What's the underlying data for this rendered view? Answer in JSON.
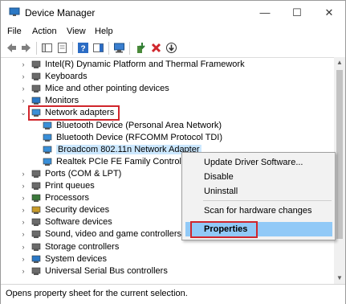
{
  "window": {
    "title": "Device Manager",
    "minimize": "—",
    "maximize": "☐",
    "close": "✕"
  },
  "menu": [
    "File",
    "Action",
    "View",
    "Help"
  ],
  "tree": [
    {
      "label": "Intel(R) Dynamic Platform and Thermal Framework",
      "icon": "platform-icon",
      "indent": 0,
      "expander": "›"
    },
    {
      "label": "Keyboards",
      "icon": "keyboard-icon",
      "indent": 0,
      "expander": "›"
    },
    {
      "label": "Mice and other pointing devices",
      "icon": "mouse-icon",
      "indent": 0,
      "expander": "›"
    },
    {
      "label": "Monitors",
      "icon": "monitor-icon",
      "indent": 0,
      "expander": "›"
    },
    {
      "label": "Network adapters",
      "icon": "network-adapter-icon",
      "indent": 0,
      "expander": "⌄",
      "boxed": true
    },
    {
      "label": "Bluetooth Device (Personal Area Network)",
      "icon": "network-adapter-icon",
      "indent": 1
    },
    {
      "label": "Bluetooth Device (RFCOMM Protocol TDI)",
      "icon": "network-adapter-icon",
      "indent": 1
    },
    {
      "label": "Broadcom 802.11n Network Adapter",
      "icon": "network-adapter-icon",
      "indent": 1,
      "selected": true
    },
    {
      "label": "Realtek PCIe FE Family Controller #",
      "icon": "network-adapter-icon",
      "indent": 1
    },
    {
      "label": "Ports (COM & LPT)",
      "icon": "port-icon",
      "indent": 0,
      "expander": "›"
    },
    {
      "label": "Print queues",
      "icon": "printer-icon",
      "indent": 0,
      "expander": "›"
    },
    {
      "label": "Processors",
      "icon": "processor-icon",
      "indent": 0,
      "expander": "›"
    },
    {
      "label": "Security devices",
      "icon": "security-icon",
      "indent": 0,
      "expander": "›"
    },
    {
      "label": "Software devices",
      "icon": "software-icon",
      "indent": 0,
      "expander": "›"
    },
    {
      "label": "Sound, video and game controllers",
      "icon": "speaker-icon",
      "indent": 0,
      "expander": "›"
    },
    {
      "label": "Storage controllers",
      "icon": "storage-icon",
      "indent": 0,
      "expander": "›"
    },
    {
      "label": "System devices",
      "icon": "system-icon",
      "indent": 0,
      "expander": "›"
    },
    {
      "label": "Universal Serial Bus controllers",
      "icon": "usb-icon",
      "indent": 0,
      "expander": "›"
    }
  ],
  "context_menu": {
    "items": [
      "Update Driver Software...",
      "Disable",
      "Uninstall",
      "Scan for hardware changes",
      "Properties"
    ]
  },
  "status": "Opens property sheet for the current selection.",
  "colors": {
    "highlight_box": "#d0262c",
    "selection": "#cce8ff",
    "menu_highlight": "#91c9f7"
  }
}
